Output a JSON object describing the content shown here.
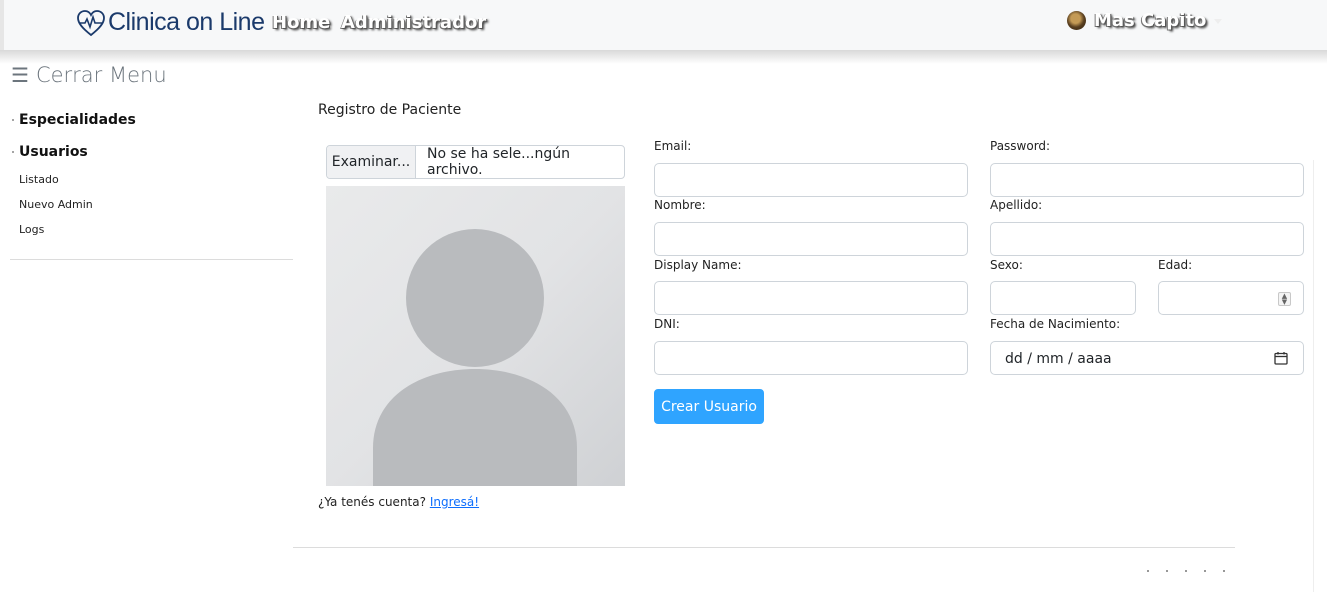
{
  "navbar": {
    "brand": "Clinica on Line",
    "links": [
      "Home",
      "Administrador"
    ],
    "user_name": "Mas Capito"
  },
  "sidebar": {
    "toggle_label": "Cerrar Menu",
    "sections": [
      {
        "label": "Especialidades",
        "items": []
      },
      {
        "label": "Usuarios",
        "items": [
          "Listado",
          "Nuevo Admin",
          "Logs"
        ]
      }
    ]
  },
  "form": {
    "title": "Registro de Paciente",
    "file_button": "Examinar...",
    "file_name": "No se ha sele...ngún archivo.",
    "labels": {
      "email": "Email:",
      "password": "Password:",
      "nombre": "Nombre:",
      "apellido": "Apellido:",
      "display_name": "Display Name:",
      "sexo": "Sexo:",
      "edad": "Edad:",
      "dni": "DNI:",
      "fecha": "Fecha de Nacimiento:"
    },
    "values": {
      "email": "",
      "password": "",
      "nombre": "",
      "apellido": "",
      "display_name": "",
      "sexo": "",
      "edad": "",
      "dni": ""
    },
    "date_placeholder": "dd / mm / aaaa",
    "submit": "Crear Usuario",
    "login_prompt": "¿Ya tenés cuenta?",
    "login_link": "Ingresá!"
  },
  "colors": {
    "primary": "#2fa4ff",
    "brand": "#1b3a6b",
    "link": "#0d6efd"
  }
}
